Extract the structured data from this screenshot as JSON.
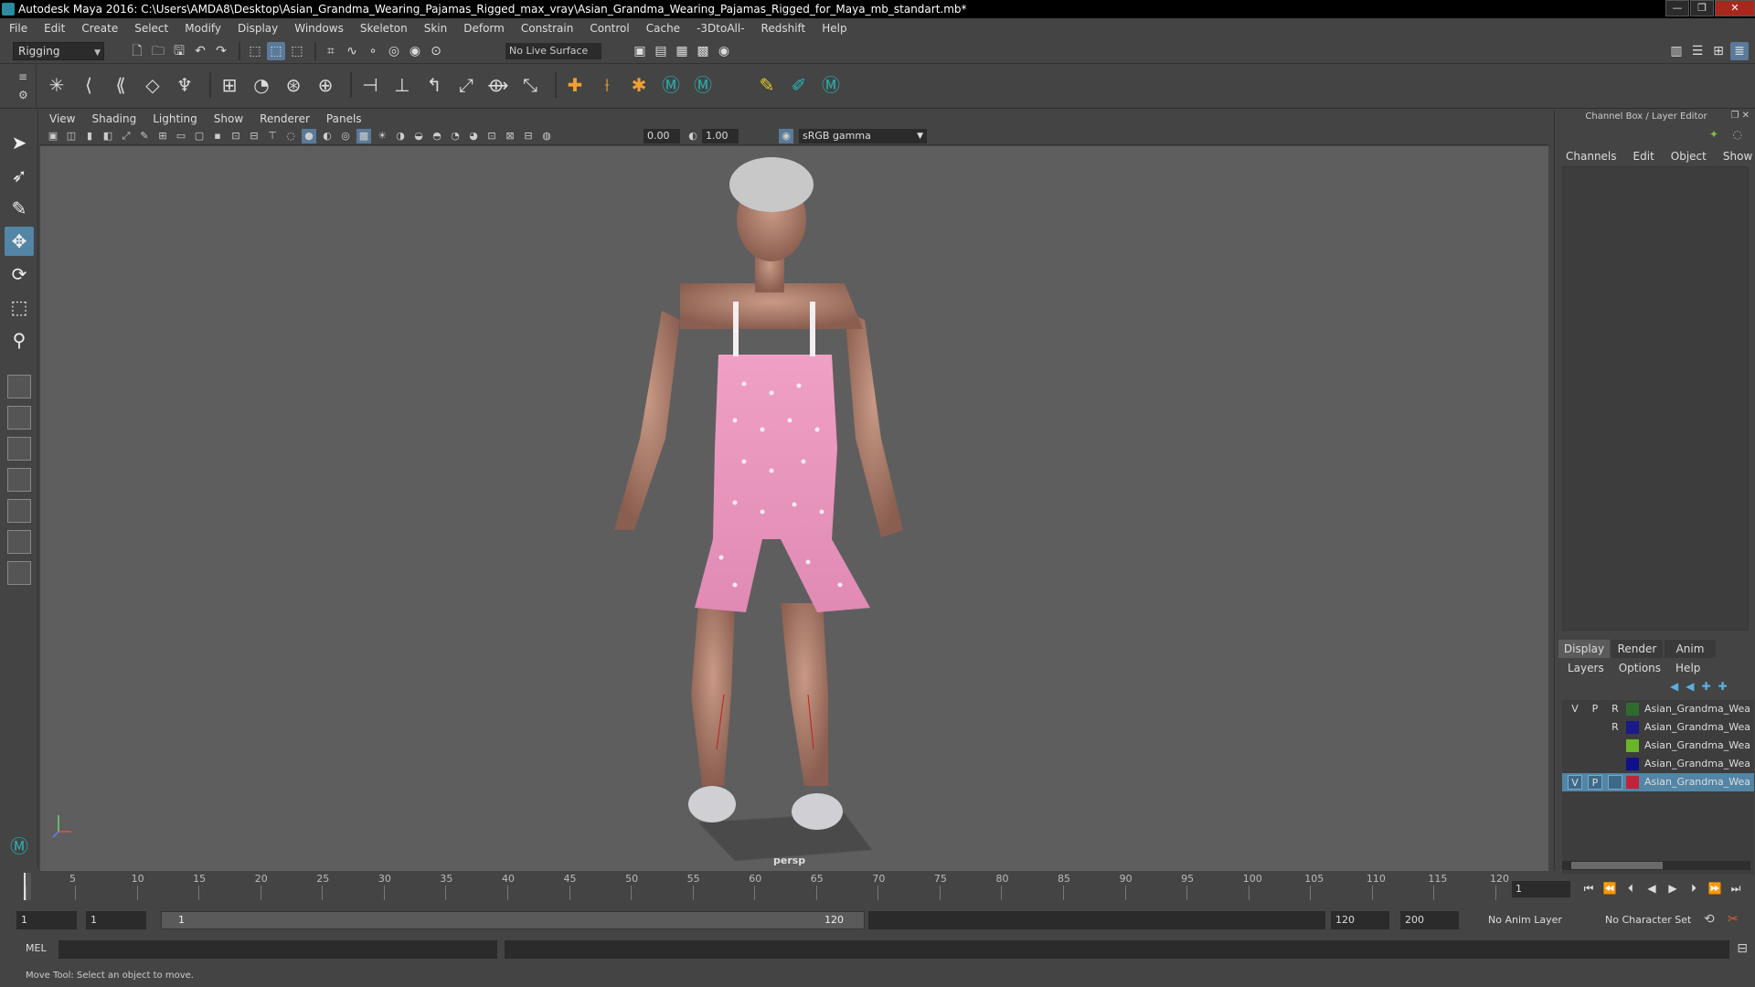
{
  "window": {
    "title": "Autodesk Maya 2016: C:\\Users\\AMDA8\\Desktop\\Asian_Grandma_Wearing_Pajamas_Rigged_max_vray\\Asian_Grandma_Wearing_Pajamas_Rigged_for_Maya_mb_standart.mb*",
    "buttons": {
      "minimize": "—",
      "maximize": "❐",
      "close": "✕"
    }
  },
  "menubar": [
    "File",
    "Edit",
    "Create",
    "Select",
    "Modify",
    "Display",
    "Windows",
    "Skeleton",
    "Skin",
    "Deform",
    "Constrain",
    "Control",
    "Cache",
    "-3DtoAll-",
    "Redshift",
    "Help"
  ],
  "statusline": {
    "mode": "Rigging",
    "live_surface": "No Live Surface"
  },
  "viewport": {
    "panel_menu": [
      "View",
      "Shading",
      "Lighting",
      "Show",
      "Renderer",
      "Panels"
    ],
    "exposure": "0.00",
    "gamma": "1.00",
    "color_space": "sRGB gamma",
    "camera": "persp"
  },
  "channelbox": {
    "title": "Channel Box / Layer Editor",
    "tabs": [
      "Channels",
      "Edit",
      "Object",
      "Show"
    ],
    "layer_tabs": [
      "Display",
      "Render",
      "Anim"
    ],
    "layer_menu": [
      "Layers",
      "Options",
      "Help"
    ],
    "layers": [
      {
        "v": "V",
        "p": "P",
        "r": "R",
        "color": "#2f6b2f",
        "name": "Asian_Grandma_Wearing_Pajamas"
      },
      {
        "v": "",
        "p": "",
        "r": "R",
        "color": "#1a1a8c",
        "name": "Asian_Grandma_Wearing_Pajamas"
      },
      {
        "v": "",
        "p": "",
        "r": "",
        "color": "#6ab42a",
        "name": "Asian_Grandma_Wearing_Pajamas"
      },
      {
        "v": "",
        "p": "",
        "r": "",
        "color": "#10108a",
        "name": "Asian_Grandma_Wearing_Pajamas"
      },
      {
        "v": "V",
        "p": "P",
        "r": "",
        "color": "#c0243a",
        "name": "Asian_Grandma_Wearing_Pajamas",
        "selected": true
      }
    ]
  },
  "timeline": {
    "ticks": [
      1,
      5,
      10,
      15,
      20,
      25,
      30,
      35,
      40,
      45,
      50,
      55,
      60,
      65,
      70,
      75,
      80,
      85,
      90,
      95,
      100,
      105,
      110,
      115,
      120
    ],
    "current_frame": "1"
  },
  "range": {
    "start": "1",
    "playback_start": "1",
    "slider_start": "1",
    "slider_end": "120",
    "playback_end": "120",
    "end": "200",
    "anim_layer": "No Anim Layer",
    "character_set": "No Character Set"
  },
  "commandline": {
    "label": "MEL"
  },
  "helpline": {
    "text": "Move Tool: Select an object to move."
  }
}
